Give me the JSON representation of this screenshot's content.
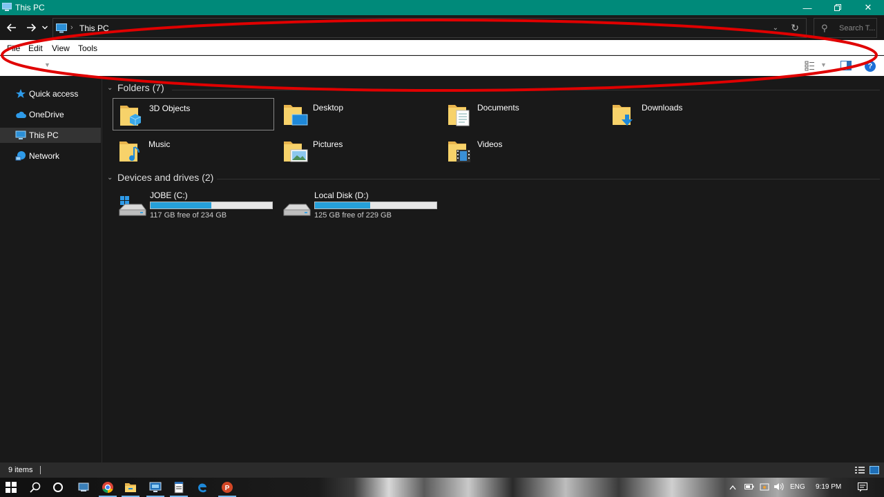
{
  "window": {
    "title": "This PC",
    "icons": {
      "app": "this-pc-icon",
      "minimize": "minimize-icon",
      "maximize": "restore-icon",
      "close": "close-icon"
    }
  },
  "nav": {
    "address_path": "This PC",
    "search_placeholder": "Search T...",
    "icons": [
      "back-arrow-icon",
      "forward-arrow-icon",
      "recent-locations-chevron-icon",
      "refresh-icon",
      "search-icon"
    ]
  },
  "menu": {
    "items": [
      {
        "label": "File"
      },
      {
        "label": "Edit"
      },
      {
        "label": "View"
      },
      {
        "label": "Tools"
      }
    ]
  },
  "sidebar": {
    "items": [
      {
        "label": "Quick access",
        "icon": "star-icon"
      },
      {
        "label": "OneDrive",
        "icon": "cloud-icon"
      },
      {
        "label": "This PC",
        "icon": "computer-icon",
        "selected": true
      },
      {
        "label": "Network",
        "icon": "network-icon"
      }
    ]
  },
  "main": {
    "folders_header": "Folders (7)",
    "folders": [
      {
        "label": "3D Objects",
        "icon": "3d-objects-folder-icon",
        "selected": true
      },
      {
        "label": "Desktop",
        "icon": "desktop-folder-icon"
      },
      {
        "label": "Documents",
        "icon": "documents-folder-icon"
      },
      {
        "label": "Downloads",
        "icon": "downloads-folder-icon"
      },
      {
        "label": "Music",
        "icon": "music-folder-icon"
      },
      {
        "label": "Pictures",
        "icon": "pictures-folder-icon"
      },
      {
        "label": "Videos",
        "icon": "videos-folder-icon"
      }
    ],
    "drives_header": "Devices and drives (2)",
    "drives": [
      {
        "name": "JOBE (C:)",
        "free_text": "117 GB free of 234 GB",
        "used_fraction": 0.5,
        "icon": "windows-drive-icon"
      },
      {
        "name": "Local Disk (D:)",
        "free_text": "125 GB free of 229 GB",
        "used_fraction": 0.454,
        "icon": "hard-drive-icon"
      }
    ]
  },
  "status": {
    "item_count": "9 items"
  },
  "taskbar": {
    "apps": [
      "windows-start-icon",
      "search-icon",
      "cortana-icon",
      "task-view-icon",
      "chrome-icon",
      "file-explorer-icon",
      "network-monitor-icon",
      "notepad-icon",
      "edge-icon",
      "powerpoint-icon"
    ],
    "tray": {
      "language": "ENG",
      "time": "9:19 PM"
    }
  },
  "annotation": {
    "shape": "ellipse",
    "color": "#e00000"
  },
  "colors": {
    "titlebar": "#008a7a",
    "accent_bar": "#26a0da",
    "annotation": "#e00000"
  }
}
